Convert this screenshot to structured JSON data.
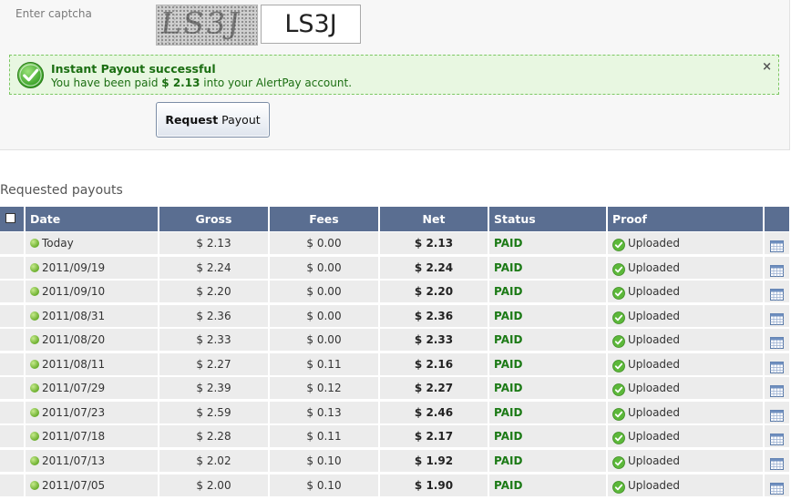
{
  "form": {
    "captcha_label": "Enter captcha",
    "captcha_image_text": "LS3J",
    "captcha_value": "LS3J",
    "button_bold": "Request",
    "button_rest": " Payout"
  },
  "alert": {
    "title": "Instant Payout successful",
    "msg_before": "You have been paid ",
    "msg_amount": "$ 2.13",
    "msg_after": " into your AlertPay account.",
    "close": "×",
    "icon": "check-circle-icon"
  },
  "section_title": "Requested payouts",
  "table": {
    "headers": {
      "date": "Date",
      "gross": "Gross",
      "fees": "Fees",
      "net": "Net",
      "status": "Status",
      "proof": "Proof"
    },
    "rows": [
      {
        "date": "Today",
        "gross": "$ 2.13",
        "fees": "$ 0.00",
        "net": "$ 2.13",
        "status": "PAID",
        "proof": "Uploaded"
      },
      {
        "date": "2011/09/19",
        "gross": "$ 2.24",
        "fees": "$ 0.00",
        "net": "$ 2.24",
        "status": "PAID",
        "proof": "Uploaded"
      },
      {
        "date": "2011/09/10",
        "gross": "$ 2.20",
        "fees": "$ 0.00",
        "net": "$ 2.20",
        "status": "PAID",
        "proof": "Uploaded"
      },
      {
        "date": "2011/08/31",
        "gross": "$ 2.36",
        "fees": "$ 0.00",
        "net": "$ 2.36",
        "status": "PAID",
        "proof": "Uploaded"
      },
      {
        "date": "2011/08/20",
        "gross": "$ 2.33",
        "fees": "$ 0.00",
        "net": "$ 2.33",
        "status": "PAID",
        "proof": "Uploaded"
      },
      {
        "date": "2011/08/11",
        "gross": "$ 2.27",
        "fees": "$ 0.11",
        "net": "$ 2.16",
        "status": "PAID",
        "proof": "Uploaded"
      },
      {
        "date": "2011/07/29",
        "gross": "$ 2.39",
        "fees": "$ 0.12",
        "net": "$ 2.27",
        "status": "PAID",
        "proof": "Uploaded"
      },
      {
        "date": "2011/07/23",
        "gross": "$ 2.59",
        "fees": "$ 0.13",
        "net": "$ 2.46",
        "status": "PAID",
        "proof": "Uploaded"
      },
      {
        "date": "2011/07/18",
        "gross": "$ 2.28",
        "fees": "$ 0.11",
        "net": "$ 2.17",
        "status": "PAID",
        "proof": "Uploaded"
      },
      {
        "date": "2011/07/13",
        "gross": "$ 2.02",
        "fees": "$ 0.10",
        "net": "$ 1.92",
        "status": "PAID",
        "proof": "Uploaded"
      },
      {
        "date": "2011/07/05",
        "gross": "$ 2.00",
        "fees": "$ 0.10",
        "net": "$ 1.90",
        "status": "PAID",
        "proof": "Uploaded"
      }
    ]
  },
  "colors": {
    "header_bg": "#5a6e91",
    "paid_green": "#1c7a16",
    "alert_bg": "#e8f7e1",
    "alert_border": "#7cc763"
  }
}
